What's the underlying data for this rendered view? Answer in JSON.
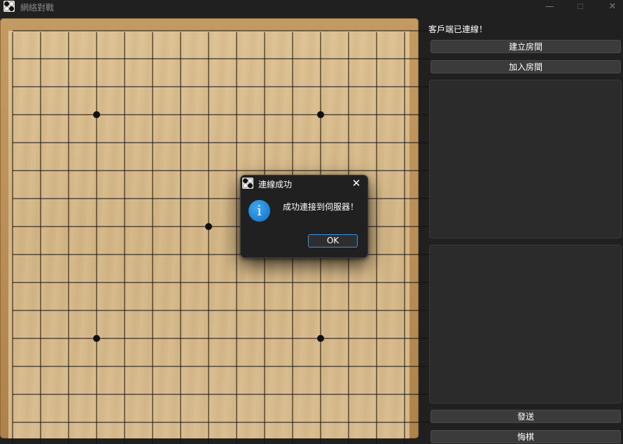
{
  "window": {
    "title": "網絡對戰",
    "minimize_glyph": "—",
    "maximize_glyph": "☐",
    "close_glyph": "✕",
    "icon": "black-white-stones-icon"
  },
  "board": {
    "lines": 15,
    "star_points": [
      [
        4,
        4
      ],
      [
        12,
        4
      ],
      [
        8,
        8
      ],
      [
        4,
        12
      ],
      [
        12,
        12
      ]
    ],
    "grid_color": "#111111",
    "wood_color": "#d6ba8b",
    "frame_color": "#b88d55"
  },
  "sidebar": {
    "status": "客戶端已連線！",
    "create_room_label": "建立房間",
    "join_room_label": "加入房間",
    "send_label": "發送",
    "undo_label": "悔棋"
  },
  "dialog": {
    "title": "連線成功",
    "message": "成功連接到伺服器！",
    "ok_label": "OK",
    "close_glyph": "✕",
    "info_glyph": "i",
    "icon": "info-icon"
  },
  "colors": {
    "background": "#202020",
    "accent": "#3f8fdd",
    "button": "#3b3b3b",
    "panel": "#2b2b2b"
  }
}
